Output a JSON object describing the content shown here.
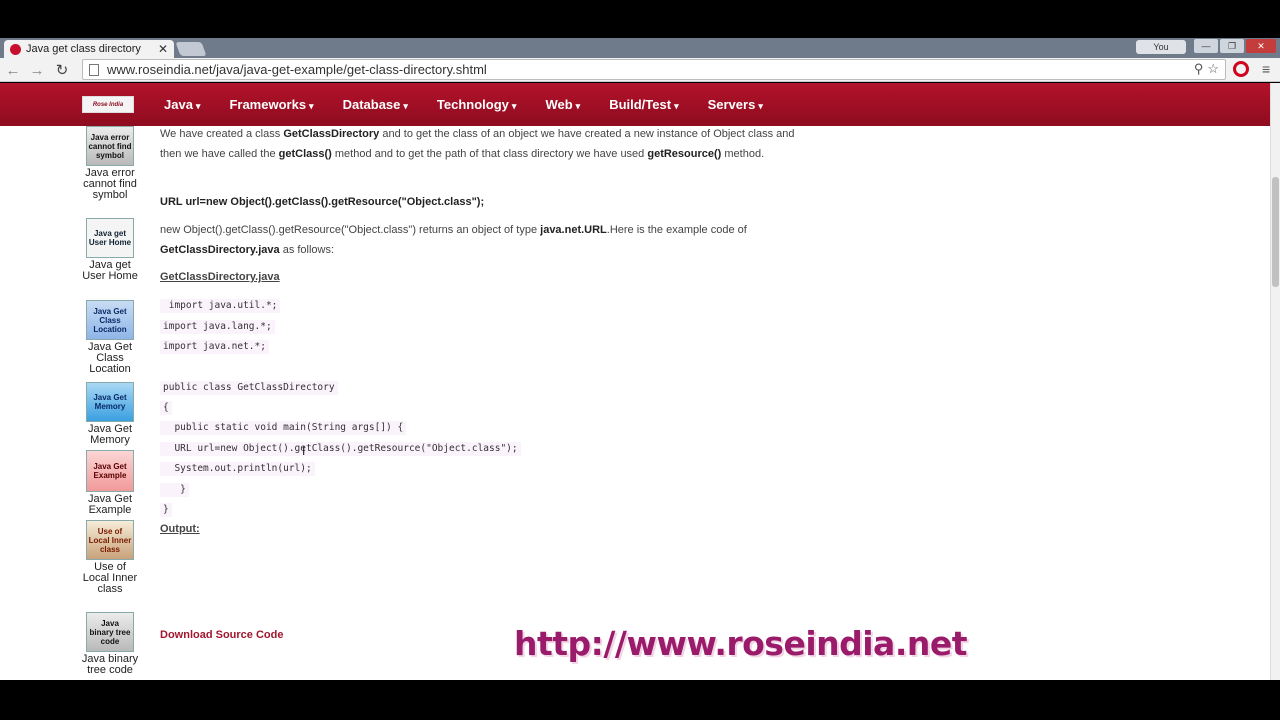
{
  "browser": {
    "tab_title": "Java get class directory",
    "tab_close": "✕",
    "profile_label": "You",
    "win_minimize": "—",
    "win_restore": "❐",
    "win_close": "✕",
    "back_glyph": "←",
    "forward_glyph": "→",
    "reload_glyph": "↻",
    "url": "www.roseindia.net/java/java-get-example/get-class-directory.shtml",
    "zoom_glyph": "⚲",
    "star_glyph": "☆",
    "menu_glyph": "≡"
  },
  "site": {
    "logo_text": "Rose India",
    "nav": [
      {
        "label": "Java"
      },
      {
        "label": "Frameworks"
      },
      {
        "label": "Database"
      },
      {
        "label": "Technology"
      },
      {
        "label": "Web"
      },
      {
        "label": "Build/Test"
      },
      {
        "label": "Servers"
      }
    ],
    "nav_caret": "▾"
  },
  "sidebar": {
    "items": [
      {
        "thumb": "Java error cannot find symbol",
        "label": "Java error cannot find symbol"
      },
      {
        "thumb": "Java get User Home",
        "label": "Java get User Home"
      },
      {
        "thumb": "Java Get Class Location",
        "label": "Java Get Class Location"
      },
      {
        "thumb": "Java Get Memory",
        "label": "Java Get Memory"
      },
      {
        "thumb": "Java Get Example",
        "label": "Java Get Example"
      },
      {
        "thumb": "Use of Local Inner class",
        "label": "Use of Local Inner class"
      },
      {
        "thumb": "Java binary tree code",
        "label": "Java binary tree code"
      }
    ]
  },
  "content": {
    "p1_a": "We have created a class ",
    "p1_b": "GetClassDirectory",
    "p1_c": " and to get the class of an object we have created a new instance of Object  class and then we have called the ",
    "p1_d": "getClass()",
    "p1_e": " method and to get the path of that class directory we have used ",
    "p1_f": "getResource()",
    "p1_g": " method.",
    "url_statement": "URL url=new Object().getClass().getResource(\"Object.class\");",
    "p2_a": "new Object().getClass().getResource(\"Object.class\") returns an object of type ",
    "p2_b": "java.net.URL",
    "p2_c": ".Here is the example code of ",
    "p2_d": "GetClassDirectory.java",
    "p2_e": " as follows:",
    "file_heading": "GetClassDirectory.java",
    "code": [
      " import java.util.*;",
      "import java.lang.*;",
      "import java.net.*;",
      "public class GetClassDirectory",
      "{",
      "  public static void main(String args[]) {",
      "  URL url=new Object().getClass().getResource(\"Object.class\");",
      "  System.out.println(url);",
      "   }",
      "}"
    ],
    "output_heading": "Output:",
    "download_link": "Download Source Code"
  },
  "watermark": "http://www.roseindia.net",
  "cursor_glyph": "I"
}
